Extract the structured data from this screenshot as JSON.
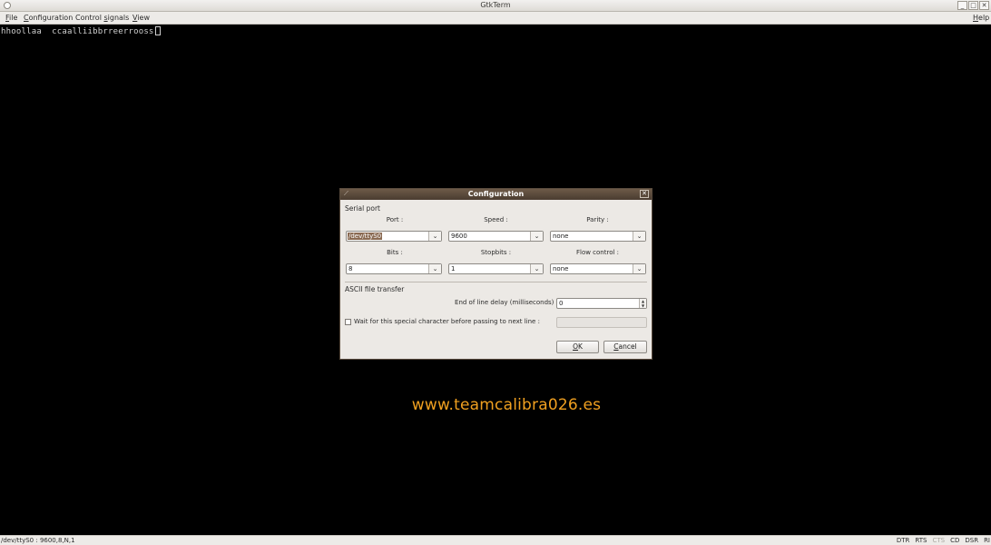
{
  "window": {
    "title": "GtkTerm",
    "controls": [
      "_",
      "□",
      "✕"
    ]
  },
  "menu": {
    "file": {
      "mnemonic": "F",
      "rest": "ile"
    },
    "configuration": {
      "mnemonic": "C",
      "rest": "onfiguration"
    },
    "control_signals": {
      "pre": "Control ",
      "mnemonic": "s",
      "rest": "ignals"
    },
    "view": {
      "mnemonic": "V",
      "rest": "iew"
    },
    "help": {
      "mnemonic": "H",
      "rest": "elp"
    }
  },
  "terminal": {
    "text": "hhoollaa  ccaalliibbrreerrooss"
  },
  "watermark": "www.teamcalibra026.es",
  "dialog": {
    "title": "Configuration",
    "serial_section": "Serial port",
    "port_label": "Port :",
    "port_value": "/dev/ttyS0",
    "speed_label": "Speed :",
    "speed_value": "9600",
    "parity_label": "Parity :",
    "parity_value": "none",
    "bits_label": "Bits :",
    "bits_value": "8",
    "stopbits_label": "Stopbits :",
    "stopbits_value": "1",
    "flow_label": "Flow control :",
    "flow_value": "none",
    "ascii_section": "ASCII file transfer",
    "eol_delay_label": "End of line delay (milliseconds) :",
    "eol_delay_value": "0",
    "wait_char_label": "Wait for this special character before passing to next line :",
    "ok": {
      "mnemonic": "O",
      "rest": "K"
    },
    "cancel": {
      "mnemonic": "C",
      "rest": "ancel"
    }
  },
  "status": {
    "info": "/dev/ttyS0 : 9600,8,N,1",
    "signals": [
      {
        "name": "DTR",
        "active": true
      },
      {
        "name": "RTS",
        "active": true
      },
      {
        "name": "CTS",
        "active": false
      },
      {
        "name": "CD",
        "active": true
      },
      {
        "name": "DSR",
        "active": true
      },
      {
        "name": "RI",
        "active": true
      }
    ]
  }
}
